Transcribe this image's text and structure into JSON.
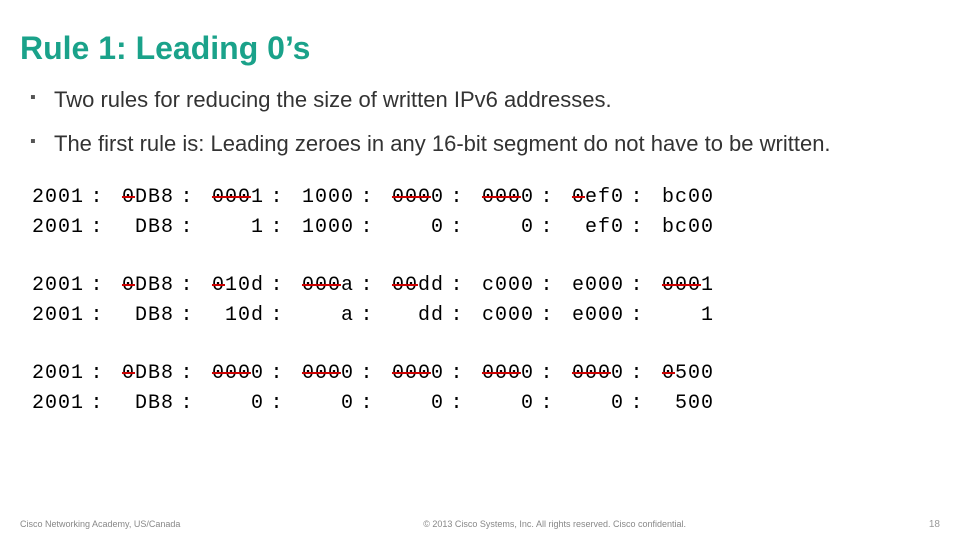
{
  "title": "Rule 1:  Leading 0’s",
  "bullets": [
    "Two rules for reducing the size of written IPv6 addresses.",
    "The first rule is: Leading zeroes in any 16-bit segment do not have to be written."
  ],
  "examples": [
    {
      "orig": [
        {
          "lead": "",
          "rest": "2001"
        },
        {
          "lead": "0",
          "rest": "DB8"
        },
        {
          "lead": "000",
          "rest": "1"
        },
        {
          "lead": "",
          "rest": "1000"
        },
        {
          "lead": "000",
          "rest": "0"
        },
        {
          "lead": "000",
          "rest": "0"
        },
        {
          "lead": "0",
          "rest": "ef0"
        },
        {
          "lead": "",
          "rest": "bc00"
        }
      ],
      "reduced": [
        "2001",
        "DB8",
        "1",
        "1000",
        "0",
        "0",
        "ef0",
        "bc00"
      ]
    },
    {
      "orig": [
        {
          "lead": "",
          "rest": "2001"
        },
        {
          "lead": "0",
          "rest": "DB8"
        },
        {
          "lead": "0",
          "rest": "10d"
        },
        {
          "lead": "000",
          "rest": "a"
        },
        {
          "lead": "00",
          "rest": "dd"
        },
        {
          "lead": "",
          "rest": "c000"
        },
        {
          "lead": "",
          "rest": "e000"
        },
        {
          "lead": "000",
          "rest": "1"
        }
      ],
      "reduced": [
        "2001",
        "DB8",
        "10d",
        "a",
        "dd",
        "c000",
        "e000",
        "1"
      ]
    },
    {
      "orig": [
        {
          "lead": "",
          "rest": "2001"
        },
        {
          "lead": "0",
          "rest": "DB8"
        },
        {
          "lead": "000",
          "rest": "0"
        },
        {
          "lead": "000",
          "rest": "0"
        },
        {
          "lead": "000",
          "rest": "0"
        },
        {
          "lead": "000",
          "rest": "0"
        },
        {
          "lead": "000",
          "rest": "0"
        },
        {
          "lead": "0",
          "rest": "500"
        }
      ],
      "reduced": [
        "2001",
        "DB8",
        "0",
        "0",
        "0",
        "0",
        "0",
        "500"
      ]
    }
  ],
  "footer": {
    "left": "Cisco Networking Academy, US/Canada",
    "center": "© 2013 Cisco Systems, Inc. All rights reserved. Cisco confidential.",
    "page": "18"
  }
}
